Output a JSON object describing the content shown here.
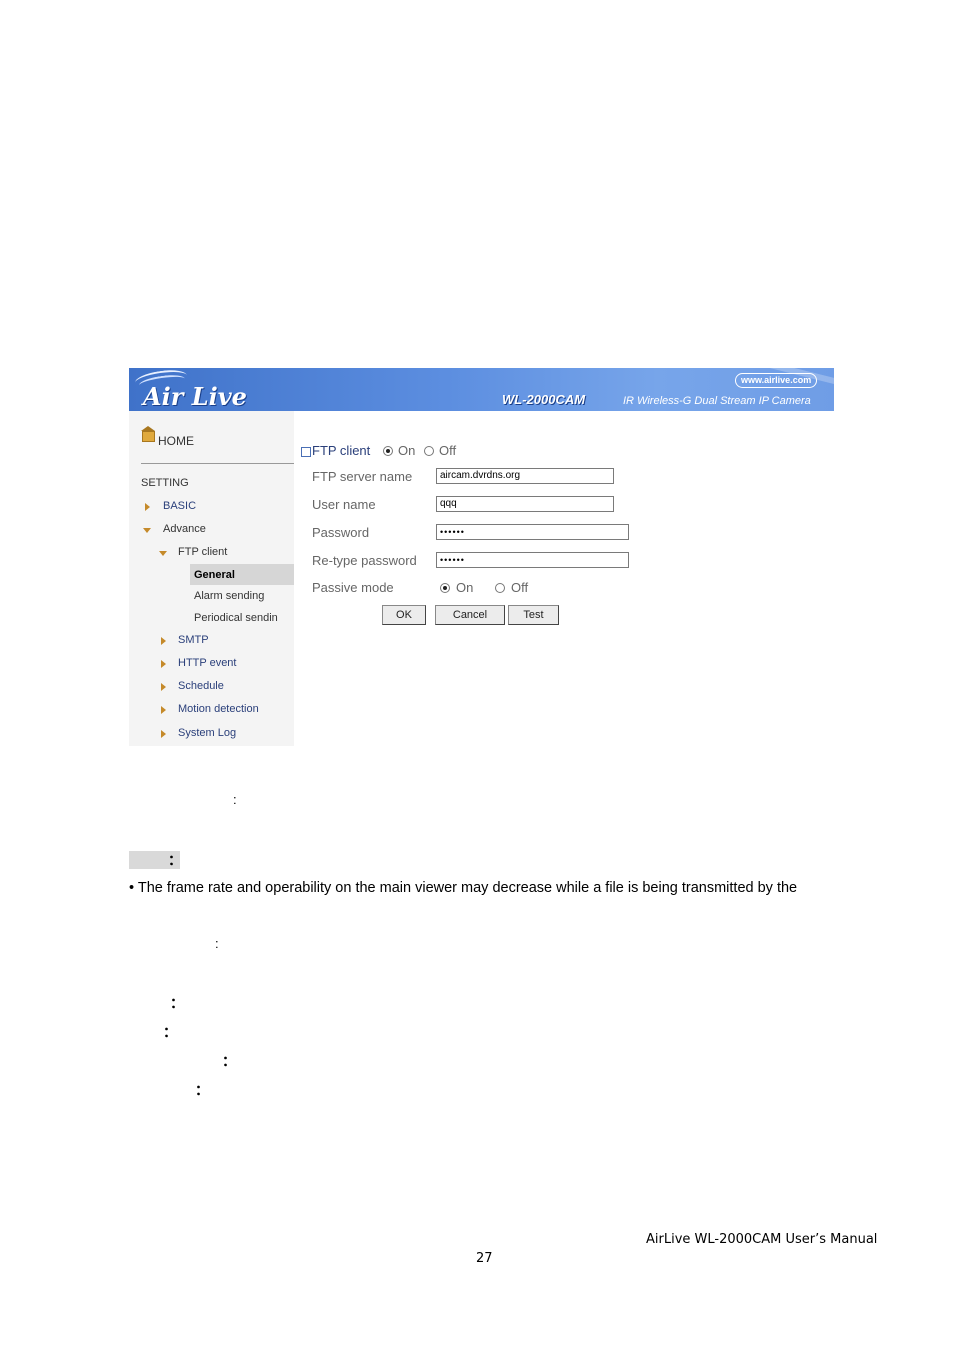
{
  "camera_ui": {
    "banner": {
      "logo": "Air Live",
      "url": "www.airlive.com",
      "model": "WL-2000CAM",
      "tagline": "IR Wireless-G Dual Stream IP Camera"
    },
    "sidebar": {
      "home": "HOME",
      "setting": "SETTING",
      "basic": "BASIC",
      "advance": "Advance",
      "ftp_client": "FTP client",
      "general": "General",
      "alarm_sending": "Alarm sending",
      "periodical_sending": "Periodical sendin",
      "smtp": "SMTP",
      "http_event": "HTTP event",
      "schedule": "Schedule",
      "motion_detection": "Motion detection",
      "system_log": "System Log"
    },
    "form": {
      "ftp_client_label": "FTP client",
      "on": "On",
      "off": "Off",
      "ftp_client_state": "On",
      "server_name_label": "FTP server name",
      "server_name_value": "aircam.dvrdns.org",
      "user_name_label": "User name",
      "user_name_value": "qqq",
      "password_label": "Password",
      "password_value": "••••••",
      "retype_label": "Re-type password",
      "retype_value": "••••••",
      "passive_label": "Passive mode",
      "passive_state": "On",
      "ok": "OK",
      "cancel": "Cancel",
      "test": "Test"
    }
  },
  "doc": {
    "colon": ":",
    "bold_colon": "：",
    "note_text": "• The frame rate and operability on the main viewer may decrease while a file is being transmitted by the"
  },
  "footer": {
    "manual": "AirLive WL-2000CAM User’s Manual",
    "page": "27"
  }
}
